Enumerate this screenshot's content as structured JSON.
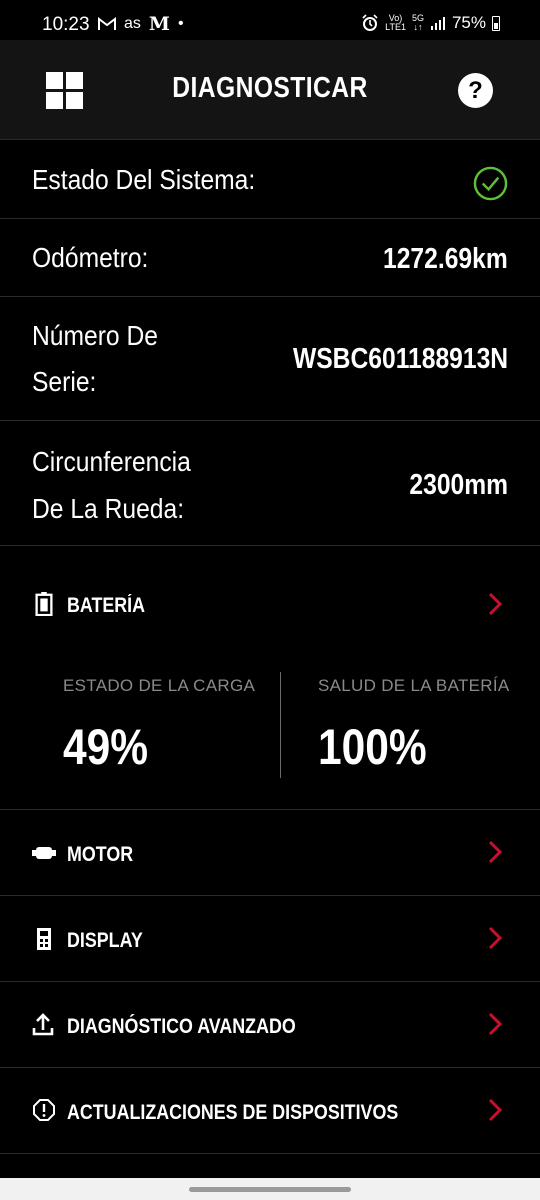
{
  "status_bar": {
    "time": "10:23",
    "left_icons": [
      "gmail-icon",
      "as",
      "M",
      "•"
    ],
    "as_label": "as",
    "m_label": "M",
    "dot": "•",
    "volte_top": "Vo)",
    "volte_bottom": "LTE1",
    "network_top": "5G",
    "network_bottom": "↓↑",
    "battery_percent": "75%"
  },
  "header": {
    "title": "DIAGNOSTICAR",
    "help_symbol": "?"
  },
  "system": {
    "status_label": "Estado Del Sistema:",
    "status_ok": true,
    "odometer_label": "Odómetro:",
    "odometer_value": "1272.69km",
    "serial_label_line1": "Número De",
    "serial_label_line2": "Serie:",
    "serial_value": "WSBC601188913N",
    "wheel_label_line1": "Circunferencia",
    "wheel_label_line2": "De La Rueda:",
    "wheel_value": "2300mm"
  },
  "battery": {
    "title": "BATERÍA",
    "charge_label": "ESTADO DE LA CARGA",
    "charge_value": "49%",
    "health_label": "SALUD DE LA BATERÍA",
    "health_value": "100%"
  },
  "menu": {
    "motor": "MOTOR",
    "display": "DISPLAY",
    "advanced": "DIAGNÓSTICO AVANZADO",
    "updates": "ACTUALIZACIONES DE DISPOSITIVOS"
  },
  "colors": {
    "background": "#000000",
    "header_bg": "#141414",
    "ok_green": "#5fbf3a",
    "chevron_red": "#c8102e",
    "muted_label": "#8a8a8a"
  }
}
